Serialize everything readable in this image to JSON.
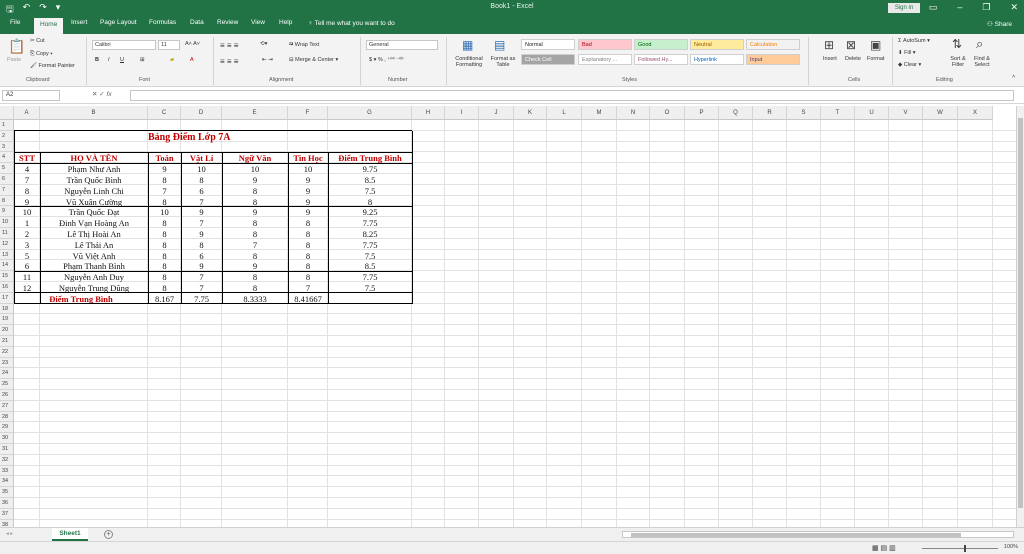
{
  "app": {
    "doc_title": "Book1 - Excel",
    "signin": "Sign in",
    "qat": [
      "save-icon",
      "undo-icon",
      "redo-icon",
      "customize-icon"
    ]
  },
  "tabs": [
    "File",
    "Home",
    "Insert",
    "Page Layout",
    "Formulas",
    "Data",
    "Review",
    "View",
    "Help"
  ],
  "active_tab": "Home",
  "tell_me": "Tell me what you want to do",
  "share": "Share",
  "ribbon": {
    "clipboard": {
      "label": "Clipboard",
      "paste": "Paste",
      "cut": "Cut",
      "copy": "Copy",
      "painter": "Format Painter"
    },
    "font": {
      "label": "Font",
      "name": "Calibri",
      "size": "11"
    },
    "alignment": {
      "label": "Alignment",
      "wrap": "Wrap Text",
      "merge": "Merge & Center"
    },
    "number": {
      "label": "Number",
      "format": "General"
    },
    "styles": {
      "label": "Styles",
      "cond": "Conditional Formatting",
      "table": "Format as Table",
      "cells": [
        {
          "name": "Normal",
          "bg": "#ffffff",
          "fg": "#222222"
        },
        {
          "name": "Bad",
          "bg": "#ffc7ce",
          "fg": "#9c0006"
        },
        {
          "name": "Good",
          "bg": "#c6efce",
          "fg": "#006100"
        },
        {
          "name": "Neutral",
          "bg": "#ffeb9c",
          "fg": "#9c5700"
        },
        {
          "name": "Calculation",
          "bg": "#f2f2f2",
          "fg": "#fa7d00"
        },
        {
          "name": "Check Cell",
          "bg": "#a5a5a5",
          "fg": "#ffffff"
        },
        {
          "name": "Explanatory ...",
          "bg": "#ffffff",
          "fg": "#7f7f7f"
        },
        {
          "name": "Followed Hy...",
          "bg": "#ffffff",
          "fg": "#954f72"
        },
        {
          "name": "Hyperlink",
          "bg": "#ffffff",
          "fg": "#0563c1"
        },
        {
          "name": "Input",
          "bg": "#ffcc99",
          "fg": "#3f3f76"
        }
      ]
    },
    "cells_group": {
      "label": "Cells",
      "insert": "Insert",
      "delete": "Delete",
      "format": "Format"
    },
    "editing": {
      "label": "Editing",
      "autosum": "AutoSum",
      "fill": "Fill",
      "clear": "Clear",
      "sort": "Sort & Filter",
      "find": "Find & Select"
    }
  },
  "name_box": "A2",
  "columns": [
    "A",
    "B",
    "C",
    "D",
    "E",
    "F",
    "G",
    "H",
    "I",
    "J",
    "K",
    "L",
    "M",
    "N",
    "O",
    "P",
    "Q",
    "R",
    "S",
    "T",
    "U",
    "V",
    "W",
    "X"
  ],
  "table": {
    "title": "Bảng Điểm Lớp 7A",
    "headers": [
      "STT",
      "HỌ VÀ TÊN",
      "Toán",
      "Vật Lí",
      "Ngữ Văn",
      "Tin Học",
      "Điểm Trung Bình"
    ],
    "rows": [
      [
        "4",
        "Phạm Như Anh",
        "9",
        "10",
        "10",
        "10",
        "9.75"
      ],
      [
        "7",
        "Trần Quốc Bình",
        "8",
        "8",
        "9",
        "9",
        "8.5"
      ],
      [
        "8",
        "Nguyễn Linh Chi",
        "7",
        "6",
        "8",
        "9",
        "7.5"
      ],
      [
        "9",
        "Vũ Xuân Cường",
        "8",
        "7",
        "8",
        "9",
        "8"
      ],
      [
        "10",
        "Trần Quốc Đạt",
        "10",
        "9",
        "9",
        "9",
        "9.25"
      ],
      [
        "1",
        "Đinh Vạn Hoàng An",
        "8",
        "7",
        "8",
        "8",
        "7.75"
      ],
      [
        "2",
        "Lê Thị Hoài An",
        "8",
        "9",
        "8",
        "8",
        "8.25"
      ],
      [
        "3",
        "Lê Thái An",
        "8",
        "8",
        "7",
        "8",
        "7.75"
      ],
      [
        "5",
        "Vũ Việt Anh",
        "8",
        "6",
        "8",
        "8",
        "7.5"
      ],
      [
        "6",
        "Phạm Thanh Bình",
        "8",
        "9",
        "9",
        "8",
        "8.5"
      ],
      [
        "11",
        "Nguyễn Anh Duy",
        "8",
        "7",
        "8",
        "8",
        "7.75"
      ],
      [
        "12",
        "Nguyễn Trung Dũng",
        "8",
        "7",
        "8",
        "7",
        "7.5"
      ]
    ],
    "footer_label": "Điểm Trung Bình",
    "footer_values": [
      "8.167",
      "7.75",
      "8.3333",
      "8.41667"
    ]
  },
  "sheet_tab": "Sheet1",
  "zoom": "100%"
}
